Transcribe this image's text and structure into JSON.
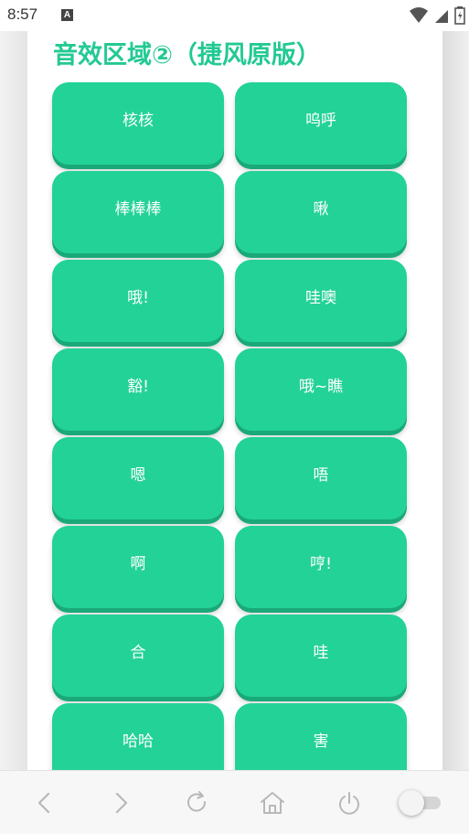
{
  "status_bar": {
    "time": "8:57",
    "notification_icon": "A",
    "icons": [
      "wifi-icon",
      "signal-icon",
      "battery-icon"
    ]
  },
  "section": {
    "title": "音效区域②（捷风原版）"
  },
  "buttons": [
    {
      "label": "核核"
    },
    {
      "label": "呜呼"
    },
    {
      "label": "棒棒棒"
    },
    {
      "label": "啾"
    },
    {
      "label": "哦!"
    },
    {
      "label": "哇噢"
    },
    {
      "label": "豁!"
    },
    {
      "label": "哦~瞧"
    },
    {
      "label": "嗯"
    },
    {
      "label": "唔"
    },
    {
      "label": "啊"
    },
    {
      "label": "哼!"
    },
    {
      "label": "合"
    },
    {
      "label": "哇"
    },
    {
      "label": "哈哈"
    },
    {
      "label": "害"
    }
  ],
  "nav": {
    "icons": [
      "back-icon",
      "forward-icon",
      "refresh-icon",
      "home-icon",
      "power-icon",
      "toggle-switch"
    ]
  },
  "colors": {
    "accent": "#23d297",
    "accent_shadow": "#1aa979",
    "title": "#23c993"
  }
}
